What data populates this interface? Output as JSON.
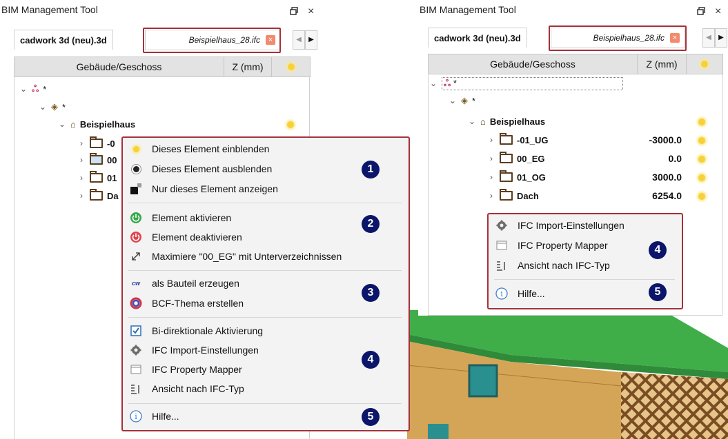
{
  "left_panel": {
    "title": "BIM Management Tool",
    "restore_icon": "restore-icon",
    "close_label": "×",
    "tab_active": "cadwork 3d (neu).3d",
    "tab_ifc": "Beispielhaus_28.ifc",
    "tab_close_label": "×",
    "nav_prev": "◀",
    "nav_next": "▶",
    "col_building": "Gebäude/Geschoss",
    "col_z": "Z (mm)",
    "tree": {
      "root_label": "*",
      "site_label": "*",
      "building_label": "Beispielhaus",
      "floors": [
        "-0",
        "00",
        "01",
        "Da"
      ]
    }
  },
  "context_menu": {
    "items": [
      {
        "label": "Dieses Element einblenden",
        "icon": "bulb-on-icon"
      },
      {
        "label": "Dieses Element ausblenden",
        "icon": "bulb-off-icon"
      },
      {
        "label": "Nur dieses Element anzeigen",
        "icon": "isolate-icon"
      },
      {
        "label": "Element aktivieren",
        "icon": "power-green-icon"
      },
      {
        "label": "Element deaktivieren",
        "icon": "power-red-icon"
      },
      {
        "label": "Maximiere \"00_EG\" mit Unterverzeichnissen",
        "icon": "expand-icon"
      },
      {
        "label": "als Bauteil erzeugen",
        "icon": "cadwork-logo-icon"
      },
      {
        "label": "BCF-Thema erstellen",
        "icon": "bcf-icon"
      },
      {
        "label": "Bi-direktionale Aktivierung",
        "icon": "checkbox-checked-icon"
      },
      {
        "label": "IFC Import-Einstellungen",
        "icon": "gear-icon"
      },
      {
        "label": "IFC Property Mapper",
        "icon": "window-icon"
      },
      {
        "label": "Ansicht nach IFC-Typ",
        "icon": "list-type-icon"
      },
      {
        "label": "Hilfe...",
        "icon": "info-icon"
      }
    ],
    "badges": [
      "1",
      "2",
      "3",
      "4",
      "5"
    ]
  },
  "right_panel": {
    "title": "BIM Management Tool",
    "restore_icon": "restore-icon",
    "close_label": "×",
    "tab_active": "cadwork 3d (neu).3d",
    "tab_ifc": "Beispielhaus_28.ifc",
    "tab_close_label": "×",
    "nav_prev": "◀",
    "nav_next": "▶",
    "col_building": "Gebäude/Geschoss",
    "col_z": "Z (mm)",
    "tree": {
      "root_label": "*",
      "site_label": "*",
      "building_label": "Beispielhaus",
      "floors": [
        {
          "label": "-01_UG",
          "z": "-3000.0"
        },
        {
          "label": "00_EG",
          "z": "0.0"
        },
        {
          "label": "01_OG",
          "z": "3000.0"
        },
        {
          "label": "Dach",
          "z": "6254.0"
        }
      ]
    }
  },
  "ifc_menu": {
    "items": [
      {
        "label": "IFC Import-Einstellungen",
        "icon": "gear-icon"
      },
      {
        "label": "IFC Property Mapper",
        "icon": "window-icon"
      },
      {
        "label": "Ansicht nach IFC-Typ",
        "icon": "list-type-icon"
      },
      {
        "label": "Hilfe...",
        "icon": "info-icon"
      }
    ],
    "badges": [
      "4",
      "5"
    ]
  },
  "colors": {
    "highlight_border": "#a5303a",
    "badge": "#0b1569",
    "roof_green": "#3fae49",
    "wall_wood": "#d4a557",
    "bulb": "#f6d13a"
  }
}
